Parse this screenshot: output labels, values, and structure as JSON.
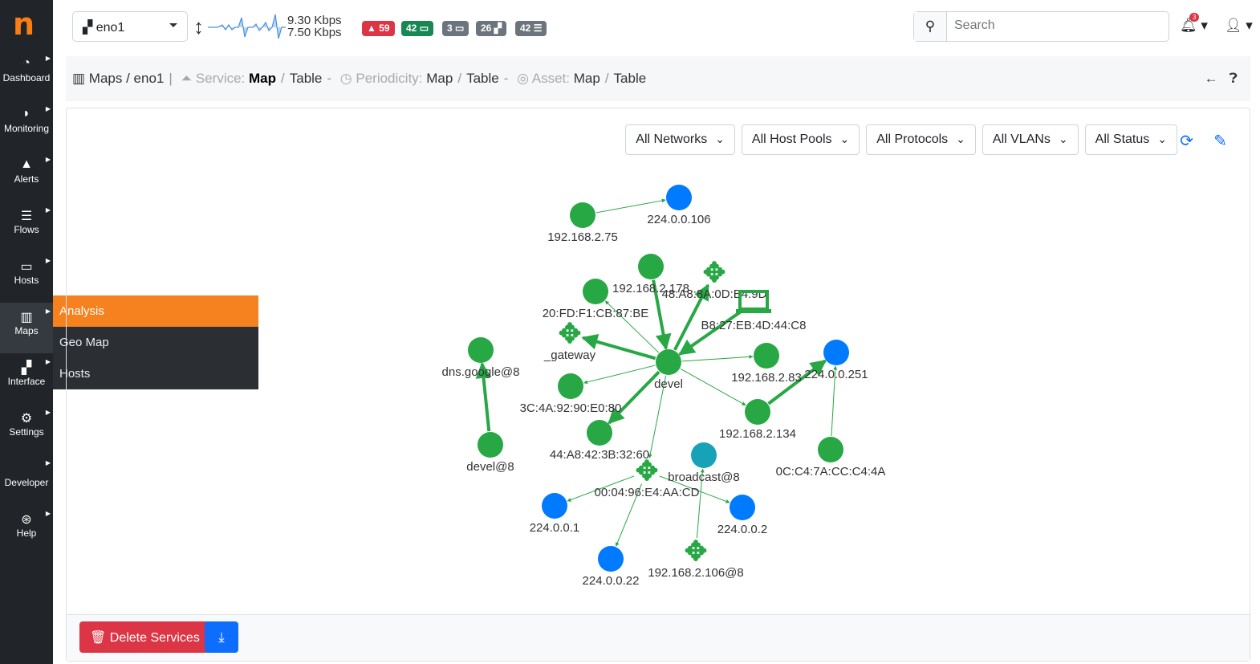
{
  "sidebar": {
    "items": [
      {
        "label": "Dashboard",
        "icon": "gauge-icon"
      },
      {
        "label": "Monitoring",
        "icon": "satellite-dish-icon"
      },
      {
        "label": "Alerts",
        "icon": "warning-icon"
      },
      {
        "label": "Flows",
        "icon": "bars-icon"
      },
      {
        "label": "Hosts",
        "icon": "laptop-icon"
      },
      {
        "label": "Maps",
        "icon": "map-icon"
      },
      {
        "label": "Interface",
        "icon": "ethernet-icon"
      },
      {
        "label": "Settings",
        "icon": "gear-icon"
      },
      {
        "label": "Developer",
        "icon": "code-icon"
      },
      {
        "label": "Help",
        "icon": "life-ring-icon"
      }
    ],
    "flyout": [
      "Analysis",
      "Geo Map",
      "Hosts"
    ]
  },
  "topbar": {
    "interface": "eno1",
    "rate_up": "9.30 Kbps",
    "rate_down": "7.50 Kbps",
    "badges": [
      {
        "value": "59",
        "icon": "warning-icon",
        "color": "#dc3545"
      },
      {
        "value": "42",
        "icon": "laptop-icon",
        "color": "#198754"
      },
      {
        "value": "3",
        "icon": "laptop-icon",
        "color": "#6c757d"
      },
      {
        "value": "26",
        "icon": "ethernet-icon",
        "color": "#6c757d"
      },
      {
        "value": "42",
        "icon": "list-icon",
        "color": "#6c757d"
      }
    ],
    "search_placeholder": "Search",
    "notifications": "3"
  },
  "breadcrumb": {
    "title": "Maps / eno1",
    "service_label": "Service:",
    "service_map": "Map",
    "service_table": "Table",
    "periodicity_label": "Periodicity:",
    "periodicity_map": "Map",
    "periodicity_table": "Table",
    "asset_label": "Asset:",
    "asset_map": "Map",
    "asset_table": "Table"
  },
  "filters": [
    "All Networks",
    "All Host Pools",
    "All Protocols",
    "All VLANs",
    "All Status"
  ],
  "footer": {
    "delete": "Delete Services"
  },
  "colors": {
    "host": "#28a745",
    "multicast": "#007bff",
    "broadcast": "#17a2b8"
  },
  "graph": {
    "nodes": [
      {
        "label": "192.168.2.75",
        "kind": "host"
      },
      {
        "label": "224.0.0.106",
        "kind": "multicast"
      },
      {
        "label": "192.168.2.178",
        "kind": "host"
      },
      {
        "label": "48:A8:8A:0D:E4:9D",
        "kind": "router"
      },
      {
        "label": "20:FD:F1:CB:87:BE",
        "kind": "host"
      },
      {
        "label": "B8:27:EB:4D:44:C8",
        "kind": "laptop"
      },
      {
        "label": "_gateway",
        "kind": "router"
      },
      {
        "label": "devel",
        "kind": "host"
      },
      {
        "label": "192.168.2.83",
        "kind": "host"
      },
      {
        "label": "224.0.0.251",
        "kind": "multicast"
      },
      {
        "label": "dns.google@8",
        "kind": "host"
      },
      {
        "label": "devel@8",
        "kind": "host"
      },
      {
        "label": "3C:4A:92:90:E0:80",
        "kind": "host"
      },
      {
        "label": "44:A8:42:3B:32:60",
        "kind": "host"
      },
      {
        "label": "192.168.2.134",
        "kind": "host"
      },
      {
        "label": "0C:C4:7A:CC:C4:4A",
        "kind": "host"
      },
      {
        "label": "broadcast@8",
        "kind": "broadcast"
      },
      {
        "label": "00:04:96:E4:AA:CD",
        "kind": "router"
      },
      {
        "label": "224.0.0.1",
        "kind": "multicast"
      },
      {
        "label": "224.0.0.2",
        "kind": "multicast"
      },
      {
        "label": "224.0.0.22",
        "kind": "multicast"
      },
      {
        "label": "192.168.2.106@8",
        "kind": "router"
      }
    ],
    "edges": [
      [
        0,
        1,
        false
      ],
      [
        2,
        7,
        true
      ],
      [
        7,
        3,
        true
      ],
      [
        5,
        7,
        true
      ],
      [
        7,
        6,
        true
      ],
      [
        7,
        4,
        false
      ],
      [
        7,
        8,
        false
      ],
      [
        7,
        12,
        false
      ],
      [
        7,
        13,
        true
      ],
      [
        7,
        14,
        false
      ],
      [
        14,
        9,
        true
      ],
      [
        15,
        9,
        false
      ],
      [
        11,
        10,
        true
      ],
      [
        7,
        17,
        false
      ],
      [
        17,
        18,
        false
      ],
      [
        17,
        19,
        false
      ],
      [
        17,
        20,
        false
      ],
      [
        21,
        16,
        false
      ]
    ]
  }
}
